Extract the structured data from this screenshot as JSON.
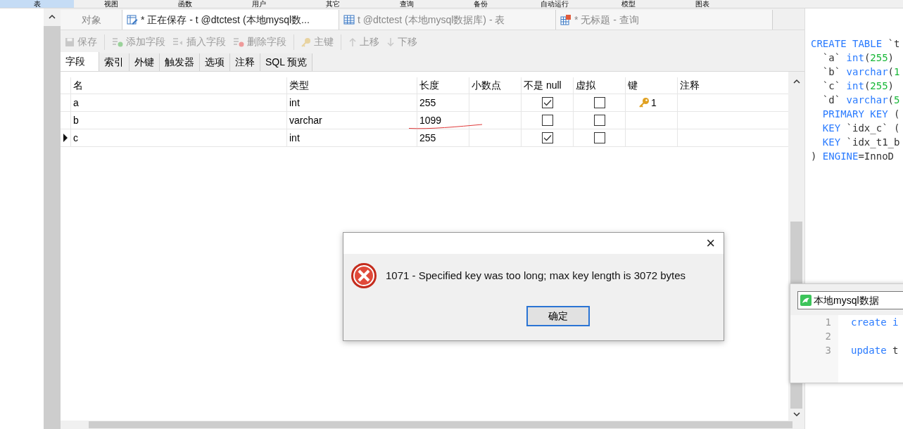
{
  "menu": [
    {
      "label": "表",
      "selected": true
    },
    {
      "label": "视图",
      "selected": false
    },
    {
      "label": "函数",
      "selected": false
    },
    {
      "label": "用户",
      "selected": false
    },
    {
      "label": "其它",
      "selected": false
    },
    {
      "label": "查询",
      "selected": false
    },
    {
      "label": "备份",
      "selected": false
    },
    {
      "label": "自动运行",
      "selected": false
    },
    {
      "label": "模型",
      "selected": false
    },
    {
      "label": "图表",
      "selected": false
    }
  ],
  "tabs": [
    {
      "label": "对象",
      "kind": "plain",
      "selected": false
    },
    {
      "label": "* 正在保存 - t @dtctest (本地mysql数...",
      "kind": "design",
      "selected": true
    },
    {
      "label": "t @dtctest (本地mysql数据库) - 表",
      "kind": "table",
      "selected": false
    },
    {
      "label": "* 无标题 - 查询",
      "kind": "query",
      "selected": false
    }
  ],
  "toolbar": [
    {
      "label": "保存",
      "kind": "save",
      "disabled": true
    },
    {
      "label": "添加字段",
      "kind": "add",
      "disabled": true
    },
    {
      "label": "插入字段",
      "kind": "insert",
      "disabled": true
    },
    {
      "label": "删除字段",
      "kind": "delete",
      "disabled": true
    },
    {
      "label": "主键",
      "kind": "key",
      "disabled": true
    },
    {
      "label": "上移",
      "kind": "up",
      "disabled": true
    },
    {
      "label": "下移",
      "kind": "down",
      "disabled": true
    }
  ],
  "subtabs": [
    {
      "label": "字段",
      "selected": true
    },
    {
      "label": "索引",
      "selected": false
    },
    {
      "label": "外键",
      "selected": false
    },
    {
      "label": "触发器",
      "selected": false
    },
    {
      "label": "选项",
      "selected": false
    },
    {
      "label": "注释",
      "selected": false
    },
    {
      "label": "SQL 预览",
      "selected": false
    }
  ],
  "table": {
    "columns": [
      "名",
      "类型",
      "长度",
      "小数点",
      "不是 null",
      "虚拟",
      "键",
      "注释"
    ],
    "rows": [
      {
        "name": "a",
        "type": "int",
        "length": "255",
        "not_null": true,
        "virtual": false,
        "key": "1",
        "current": false,
        "marked": false
      },
      {
        "name": "b",
        "type": "varchar",
        "length": "1099",
        "not_null": false,
        "virtual": false,
        "current": false,
        "marked": true
      },
      {
        "name": "c",
        "type": "int",
        "length": "255",
        "not_null": true,
        "virtual": false,
        "current": true,
        "marked": false
      }
    ]
  },
  "sql_preview": [
    [
      {
        "text": "CREATE TABLE",
        "kind": "kw"
      },
      {
        "text": " `t",
        "kind": "id"
      }
    ],
    [
      {
        "text": "  `a` ",
        "kind": "id"
      },
      {
        "text": "int",
        "kind": "kw"
      },
      {
        "text": "(",
        "kind": "id"
      },
      {
        "text": "255",
        "kind": "num"
      },
      {
        "text": ")",
        "kind": "id"
      }
    ],
    [
      {
        "text": "  `b` ",
        "kind": "id"
      },
      {
        "text": "varchar",
        "kind": "kw"
      },
      {
        "text": "(",
        "kind": "id"
      },
      {
        "text": "1",
        "kind": "num"
      }
    ],
    [
      {
        "text": "  `c` ",
        "kind": "id"
      },
      {
        "text": "int",
        "kind": "kw"
      },
      {
        "text": "(",
        "kind": "id"
      },
      {
        "text": "255",
        "kind": "num"
      },
      {
        "text": ")",
        "kind": "id"
      }
    ],
    [
      {
        "text": "  `d` ",
        "kind": "id"
      },
      {
        "text": "varchar",
        "kind": "kw"
      },
      {
        "text": "(",
        "kind": "id"
      },
      {
        "text": "5",
        "kind": "num"
      }
    ],
    [
      {
        "text": "  PRIMARY KEY",
        "kind": "kw"
      },
      {
        "text": " (",
        "kind": "id"
      }
    ],
    [
      {
        "text": "  KEY",
        "kind": "kw"
      },
      {
        "text": " `idx_c` (",
        "kind": "id"
      }
    ],
    [
      {
        "text": "  KEY",
        "kind": "kw"
      },
      {
        "text": " `idx_t1_b",
        "kind": "id"
      }
    ],
    [
      {
        "text": ") ",
        "kind": "id"
      },
      {
        "text": "ENGINE",
        "kind": "kw"
      },
      {
        "text": "=InnoD",
        "kind": "id"
      }
    ]
  ],
  "dialog": {
    "close": "×",
    "message": "1071 - Specified key was too long; max key length is 3072 bytes",
    "button": "确定"
  },
  "query_window": {
    "tab": "本地mysql数据",
    "lines": [
      {
        "number": "1",
        "tokens": [
          {
            "text": "create i",
            "kind": "kw"
          }
        ]
      },
      {
        "number": "2"
      },
      {
        "number": "3",
        "tokens": [
          {
            "text": "update",
            "kind": "kw"
          },
          {
            "text": " t",
            "kind": "id"
          }
        ]
      }
    ]
  }
}
